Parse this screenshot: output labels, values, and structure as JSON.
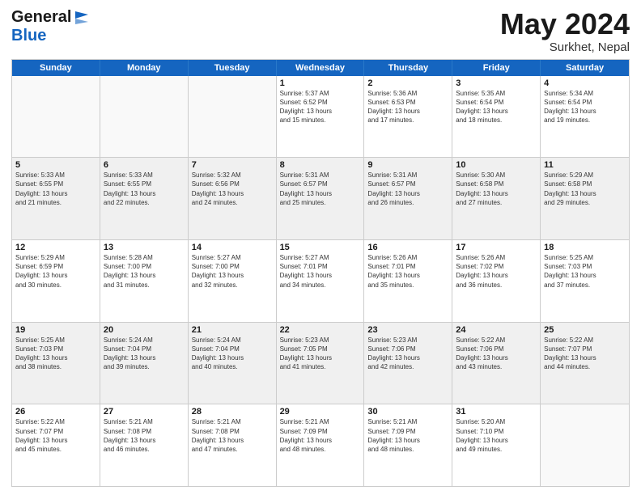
{
  "header": {
    "logo_line1": "General",
    "logo_line2": "Blue",
    "month": "May 2024",
    "location": "Surkhet, Nepal"
  },
  "days_of_week": [
    "Sunday",
    "Monday",
    "Tuesday",
    "Wednesday",
    "Thursday",
    "Friday",
    "Saturday"
  ],
  "rows": [
    [
      {
        "day": "",
        "info": ""
      },
      {
        "day": "",
        "info": ""
      },
      {
        "day": "",
        "info": ""
      },
      {
        "day": "1",
        "info": "Sunrise: 5:37 AM\nSunset: 6:52 PM\nDaylight: 13 hours\nand 15 minutes."
      },
      {
        "day": "2",
        "info": "Sunrise: 5:36 AM\nSunset: 6:53 PM\nDaylight: 13 hours\nand 17 minutes."
      },
      {
        "day": "3",
        "info": "Sunrise: 5:35 AM\nSunset: 6:54 PM\nDaylight: 13 hours\nand 18 minutes."
      },
      {
        "day": "4",
        "info": "Sunrise: 5:34 AM\nSunset: 6:54 PM\nDaylight: 13 hours\nand 19 minutes."
      }
    ],
    [
      {
        "day": "5",
        "info": "Sunrise: 5:33 AM\nSunset: 6:55 PM\nDaylight: 13 hours\nand 21 minutes."
      },
      {
        "day": "6",
        "info": "Sunrise: 5:33 AM\nSunset: 6:55 PM\nDaylight: 13 hours\nand 22 minutes."
      },
      {
        "day": "7",
        "info": "Sunrise: 5:32 AM\nSunset: 6:56 PM\nDaylight: 13 hours\nand 24 minutes."
      },
      {
        "day": "8",
        "info": "Sunrise: 5:31 AM\nSunset: 6:57 PM\nDaylight: 13 hours\nand 25 minutes."
      },
      {
        "day": "9",
        "info": "Sunrise: 5:31 AM\nSunset: 6:57 PM\nDaylight: 13 hours\nand 26 minutes."
      },
      {
        "day": "10",
        "info": "Sunrise: 5:30 AM\nSunset: 6:58 PM\nDaylight: 13 hours\nand 27 minutes."
      },
      {
        "day": "11",
        "info": "Sunrise: 5:29 AM\nSunset: 6:58 PM\nDaylight: 13 hours\nand 29 minutes."
      }
    ],
    [
      {
        "day": "12",
        "info": "Sunrise: 5:29 AM\nSunset: 6:59 PM\nDaylight: 13 hours\nand 30 minutes."
      },
      {
        "day": "13",
        "info": "Sunrise: 5:28 AM\nSunset: 7:00 PM\nDaylight: 13 hours\nand 31 minutes."
      },
      {
        "day": "14",
        "info": "Sunrise: 5:27 AM\nSunset: 7:00 PM\nDaylight: 13 hours\nand 32 minutes."
      },
      {
        "day": "15",
        "info": "Sunrise: 5:27 AM\nSunset: 7:01 PM\nDaylight: 13 hours\nand 34 minutes."
      },
      {
        "day": "16",
        "info": "Sunrise: 5:26 AM\nSunset: 7:01 PM\nDaylight: 13 hours\nand 35 minutes."
      },
      {
        "day": "17",
        "info": "Sunrise: 5:26 AM\nSunset: 7:02 PM\nDaylight: 13 hours\nand 36 minutes."
      },
      {
        "day": "18",
        "info": "Sunrise: 5:25 AM\nSunset: 7:03 PM\nDaylight: 13 hours\nand 37 minutes."
      }
    ],
    [
      {
        "day": "19",
        "info": "Sunrise: 5:25 AM\nSunset: 7:03 PM\nDaylight: 13 hours\nand 38 minutes."
      },
      {
        "day": "20",
        "info": "Sunrise: 5:24 AM\nSunset: 7:04 PM\nDaylight: 13 hours\nand 39 minutes."
      },
      {
        "day": "21",
        "info": "Sunrise: 5:24 AM\nSunset: 7:04 PM\nDaylight: 13 hours\nand 40 minutes."
      },
      {
        "day": "22",
        "info": "Sunrise: 5:23 AM\nSunset: 7:05 PM\nDaylight: 13 hours\nand 41 minutes."
      },
      {
        "day": "23",
        "info": "Sunrise: 5:23 AM\nSunset: 7:06 PM\nDaylight: 13 hours\nand 42 minutes."
      },
      {
        "day": "24",
        "info": "Sunrise: 5:22 AM\nSunset: 7:06 PM\nDaylight: 13 hours\nand 43 minutes."
      },
      {
        "day": "25",
        "info": "Sunrise: 5:22 AM\nSunset: 7:07 PM\nDaylight: 13 hours\nand 44 minutes."
      }
    ],
    [
      {
        "day": "26",
        "info": "Sunrise: 5:22 AM\nSunset: 7:07 PM\nDaylight: 13 hours\nand 45 minutes."
      },
      {
        "day": "27",
        "info": "Sunrise: 5:21 AM\nSunset: 7:08 PM\nDaylight: 13 hours\nand 46 minutes."
      },
      {
        "day": "28",
        "info": "Sunrise: 5:21 AM\nSunset: 7:08 PM\nDaylight: 13 hours\nand 47 minutes."
      },
      {
        "day": "29",
        "info": "Sunrise: 5:21 AM\nSunset: 7:09 PM\nDaylight: 13 hours\nand 48 minutes."
      },
      {
        "day": "30",
        "info": "Sunrise: 5:21 AM\nSunset: 7:09 PM\nDaylight: 13 hours\nand 48 minutes."
      },
      {
        "day": "31",
        "info": "Sunrise: 5:20 AM\nSunset: 7:10 PM\nDaylight: 13 hours\nand 49 minutes."
      },
      {
        "day": "",
        "info": ""
      }
    ]
  ]
}
